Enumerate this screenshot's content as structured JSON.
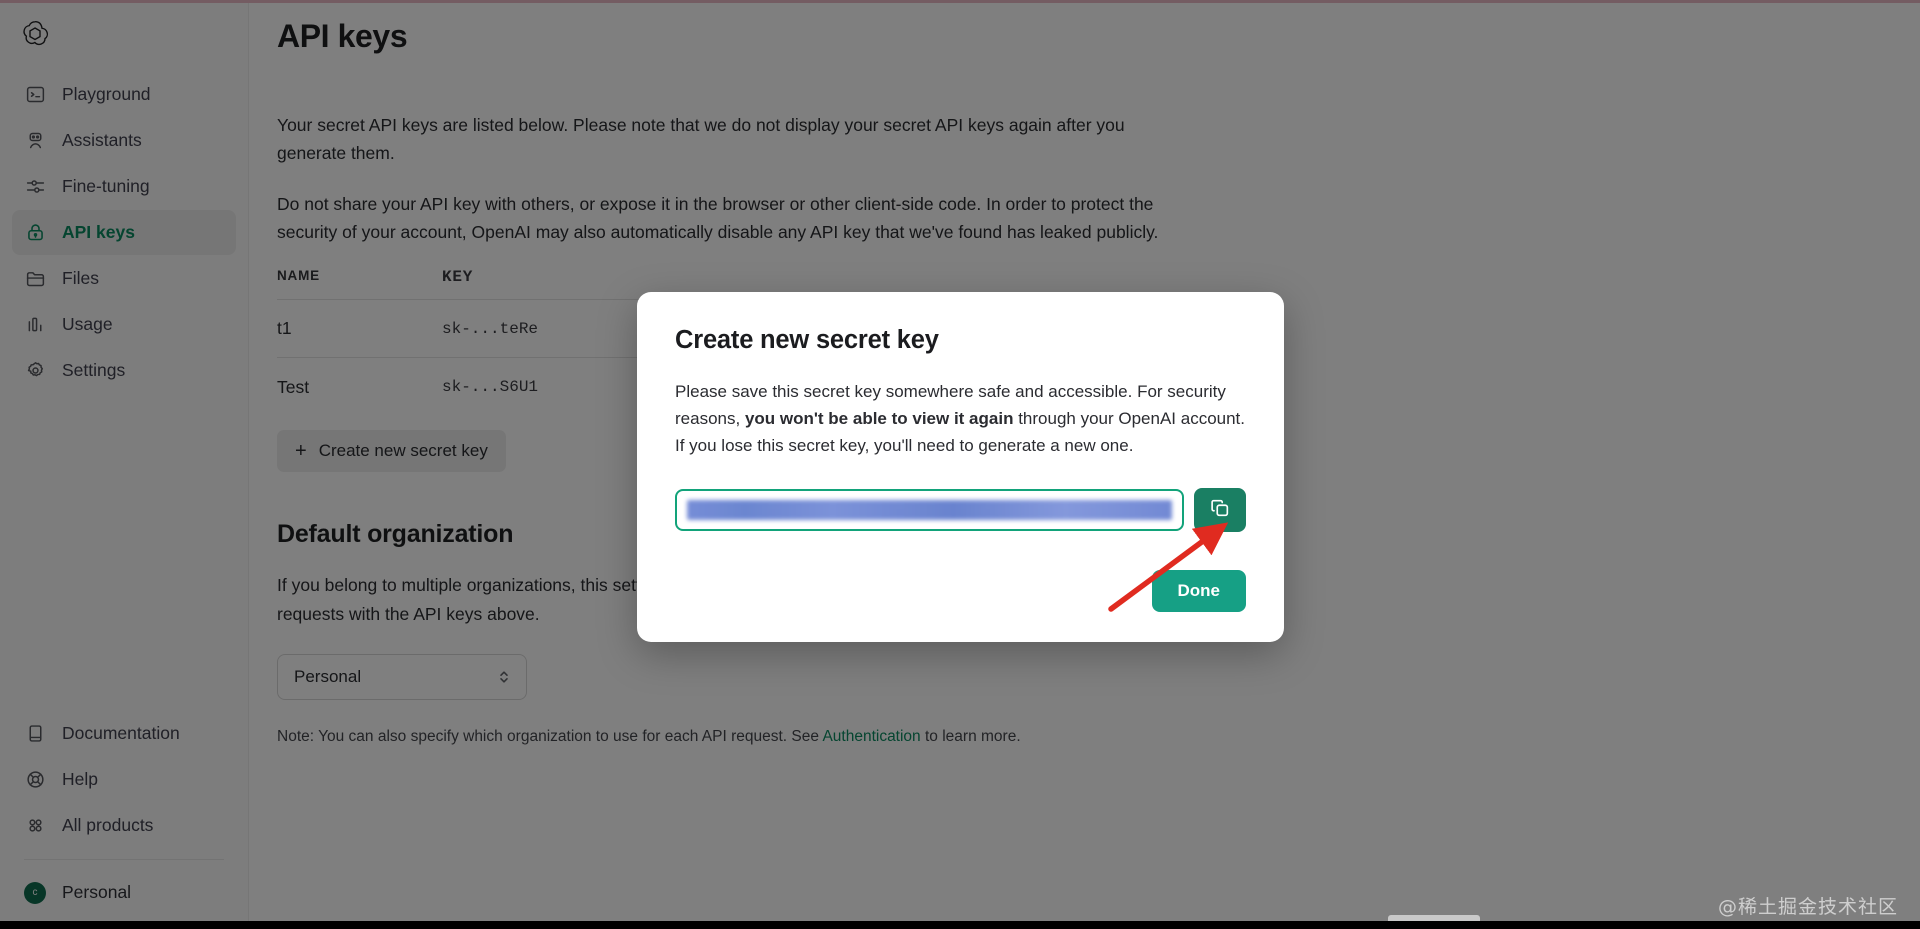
{
  "sidebar": {
    "logo": "openai-logo",
    "items": [
      {
        "label": "Playground",
        "icon": "playground-icon",
        "active": false
      },
      {
        "label": "Assistants",
        "icon": "assistants-icon",
        "active": false
      },
      {
        "label": "Fine-tuning",
        "icon": "fine-tuning-icon",
        "active": false
      },
      {
        "label": "API keys",
        "icon": "lock-icon",
        "active": true
      },
      {
        "label": "Files",
        "icon": "folder-icon",
        "active": false
      },
      {
        "label": "Usage",
        "icon": "usage-chart-icon",
        "active": false
      },
      {
        "label": "Settings",
        "icon": "gear-icon",
        "active": false
      }
    ],
    "bottom_items": [
      {
        "label": "Documentation",
        "icon": "book-icon"
      },
      {
        "label": "Help",
        "icon": "lifebuoy-icon"
      },
      {
        "label": "All products",
        "icon": "grid-dots-icon"
      }
    ],
    "org": {
      "label": "Personal",
      "avatar_initial": "c",
      "avatar_color": "#0f6c4e"
    }
  },
  "main": {
    "title": "API keys",
    "paragraphs": [
      "Your secret API keys are listed below. Please note that we do not display your secret API keys again after you generate them.",
      "Do not share your API key with others, or expose it in the browser or other client-side code. In order to protect the security of your account, OpenAI may also automatically disable any API key that we've found has leaked publicly."
    ],
    "table": {
      "columns": [
        "NAME",
        "KEY"
      ],
      "rows": [
        {
          "name": "t1",
          "key": "sk-...teRe"
        },
        {
          "name": "Test",
          "key": "sk-...S6U1"
        }
      ]
    },
    "create_button": {
      "label": "Create new secret key",
      "plus": "+"
    },
    "default_org": {
      "title": "Default organization",
      "description": "If you belong to multiple organizations, this setting controls which organization is used by default when making requests with the API keys above.",
      "selected": "Personal",
      "note_before": "Note: You can also specify which organization to use for each API request. See ",
      "note_link": "Authentication",
      "note_after": " to learn more."
    }
  },
  "modal": {
    "title": "Create new secret key",
    "body_part1": "Please save this secret key somewhere safe and accessible. For security reasons, ",
    "body_bold": "you won't be able to view it again",
    "body_part2": " through your OpenAI account. If you lose this secret key, you'll need to generate a new one.",
    "key_value": "",
    "copy_icon": "copy-icon",
    "done_label": "Done"
  },
  "annotation": {
    "type": "red-arrow",
    "color": "#e02b20"
  },
  "watermark": {
    "text": "@稀土掘金技术社区"
  },
  "colors": {
    "brand_green": "#0b8a60",
    "done_green": "#16a085",
    "copy_green": "#1a7f63",
    "scrim": "rgba(0,0,0,0.50)",
    "accent_pink": "#e8b9c4"
  }
}
